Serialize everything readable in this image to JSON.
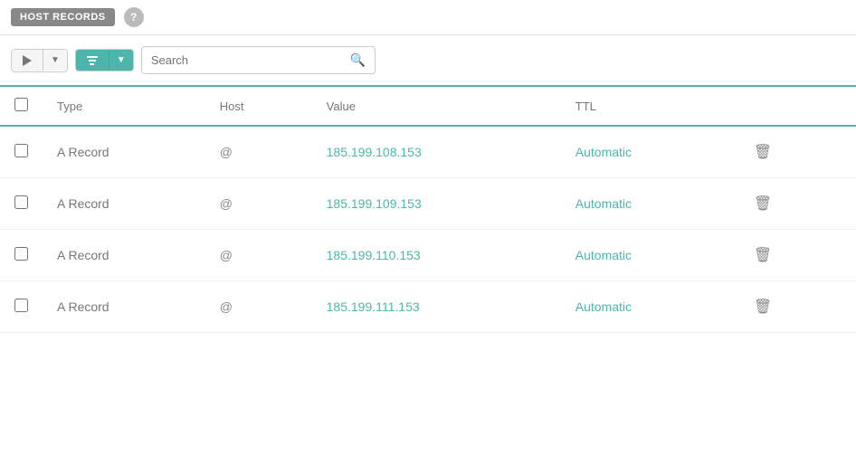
{
  "header": {
    "badge_label": "HOST RECORDS",
    "help_symbol": "?"
  },
  "toolbar": {
    "search_placeholder": "Search",
    "search_icon": "🔍"
  },
  "table": {
    "columns": [
      "Type",
      "Host",
      "Value",
      "TTL"
    ],
    "rows": [
      {
        "type": "A Record",
        "host": "@",
        "value": "185.199.108.153",
        "ttl": "Automatic"
      },
      {
        "type": "A Record",
        "host": "@",
        "value": "185.199.109.153",
        "ttl": "Automatic"
      },
      {
        "type": "A Record",
        "host": "@",
        "value": "185.199.110.153",
        "ttl": "Automatic"
      },
      {
        "type": "A Record",
        "host": "@",
        "value": "185.199.111.153",
        "ttl": "Automatic"
      }
    ]
  }
}
